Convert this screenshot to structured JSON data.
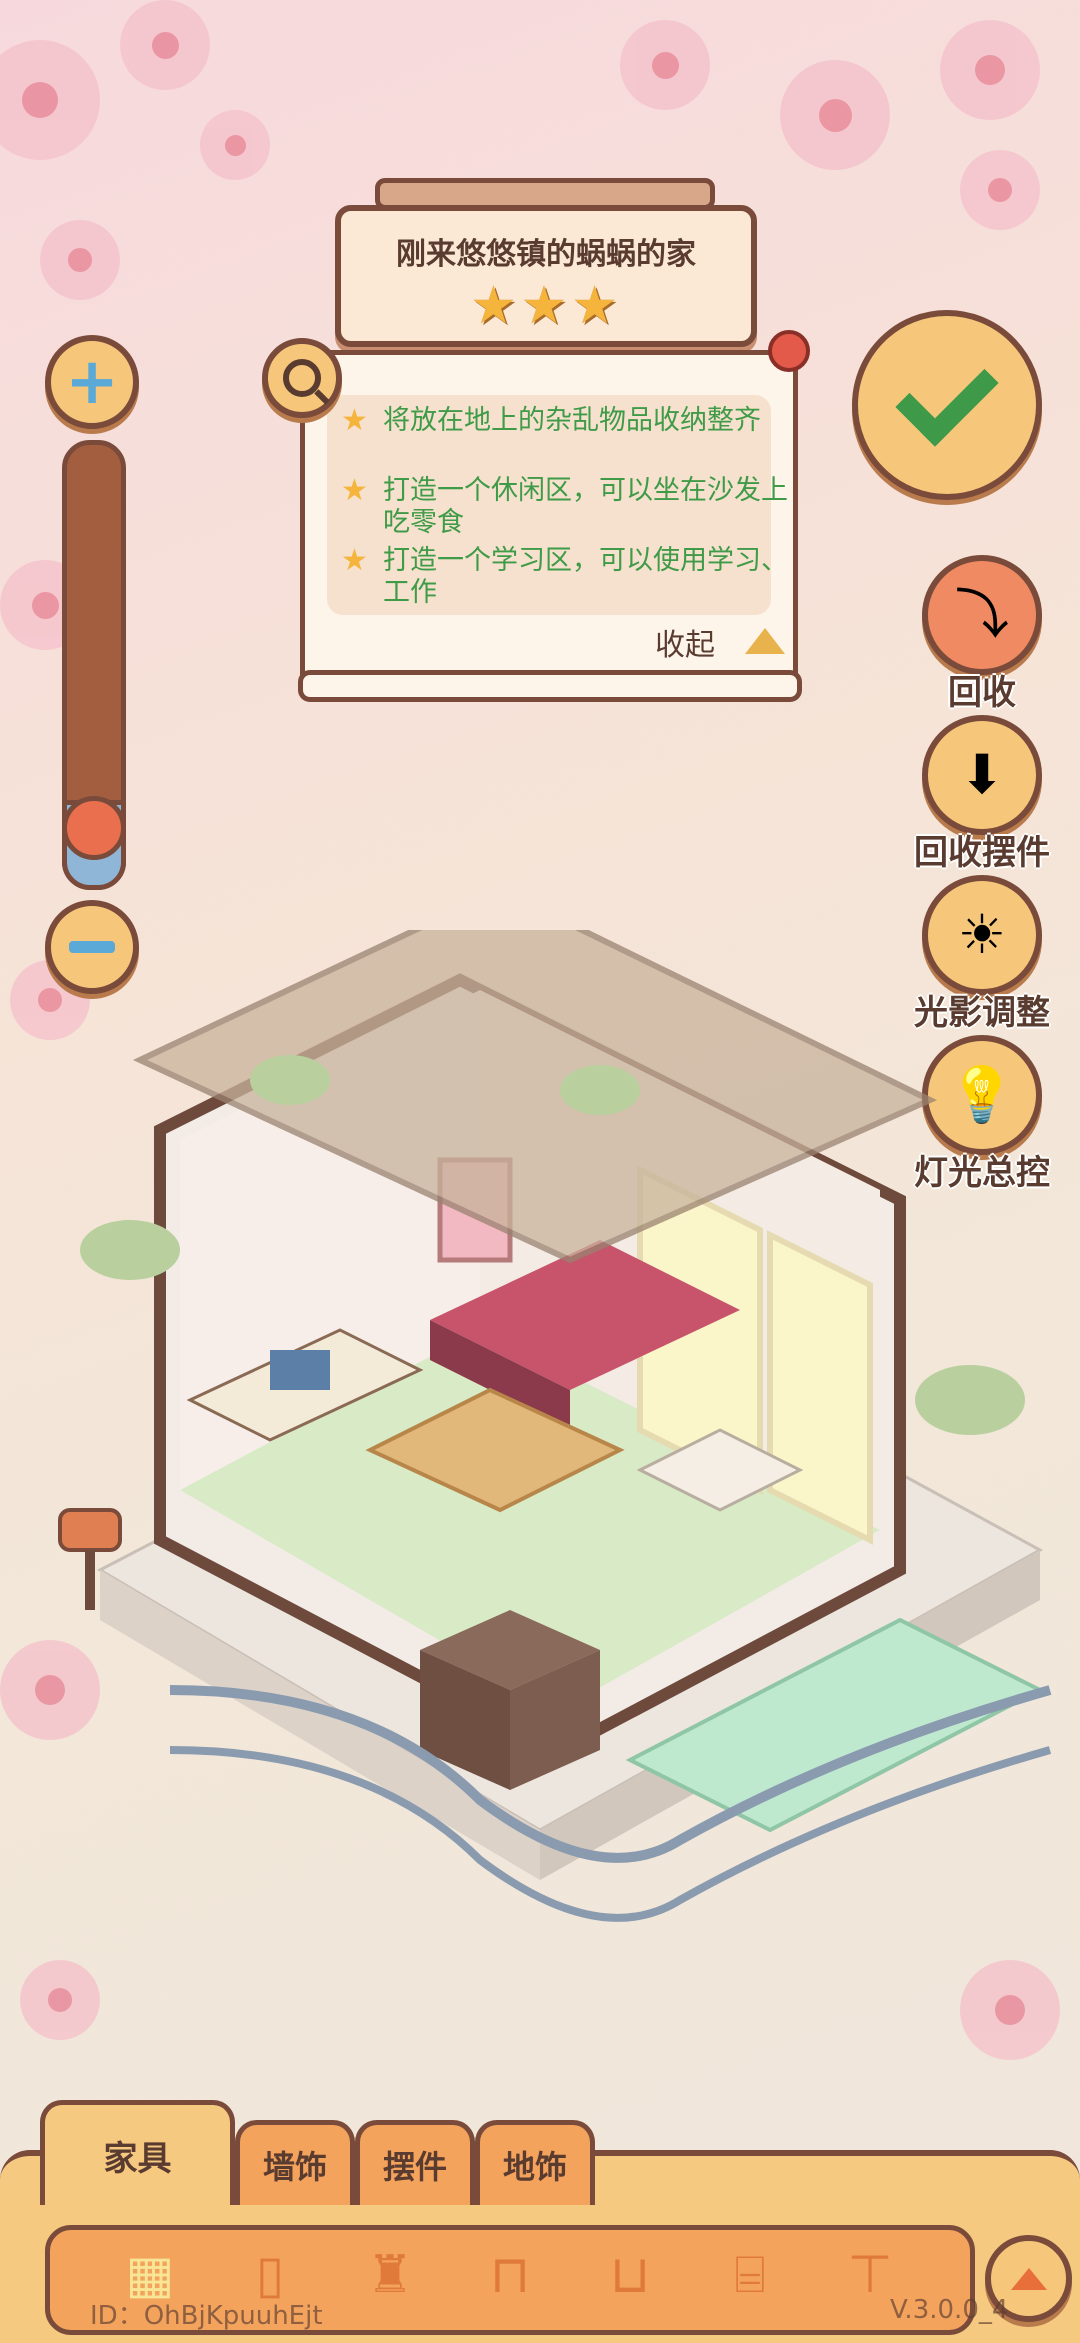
{
  "room": {
    "title": "刚来悠悠镇的蜗蜗的家",
    "stars_display": "★★★",
    "rating": 3
  },
  "tasks": [
    {
      "text": "将放在地上的杂乱物品收纳整齐"
    },
    {
      "text": "打造一个休闲区，可以坐在沙发上吃零食"
    },
    {
      "text": "打造一个学习区，可以使用学习、工作"
    }
  ],
  "collapse_label": "收起",
  "zoom": {
    "level_fraction": 0.15
  },
  "side_actions": [
    {
      "label": "回收",
      "icon": "recycle-tray-icon",
      "glyph": "⤵"
    },
    {
      "label": "回收摆件",
      "icon": "recycle-box-icon",
      "glyph": "⬇"
    },
    {
      "label": "光影调整",
      "icon": "sun-moon-icon",
      "glyph": "☀"
    },
    {
      "label": "灯光总控",
      "icon": "lightbulb-icon",
      "glyph": "💡"
    }
  ],
  "tabs": [
    {
      "label": "家具",
      "active": true
    },
    {
      "label": "墙饰",
      "active": false
    },
    {
      "label": "摆件",
      "active": false
    },
    {
      "label": "地饰",
      "active": false
    }
  ],
  "tools": [
    {
      "name": "all-grid-icon",
      "glyph": "▦"
    },
    {
      "name": "fridge-icon",
      "glyph": "▯"
    },
    {
      "name": "toilet-icon",
      "glyph": "♜"
    },
    {
      "name": "chair-icon",
      "glyph": "⊓"
    },
    {
      "name": "bed-icon",
      "glyph": "⊔"
    },
    {
      "name": "cabinet-icon",
      "glyph": "⌸"
    },
    {
      "name": "table-icon",
      "glyph": "⊤"
    }
  ],
  "footer": {
    "id_text": "ID：OhBjKpuuhEjt",
    "version": "V.3.0.0_4"
  },
  "colors": {
    "wood_dark": "#7a4b3a",
    "panel_orange": "#f6c980",
    "task_green": "#3f9b47",
    "star_gold": "#f5b43b"
  }
}
